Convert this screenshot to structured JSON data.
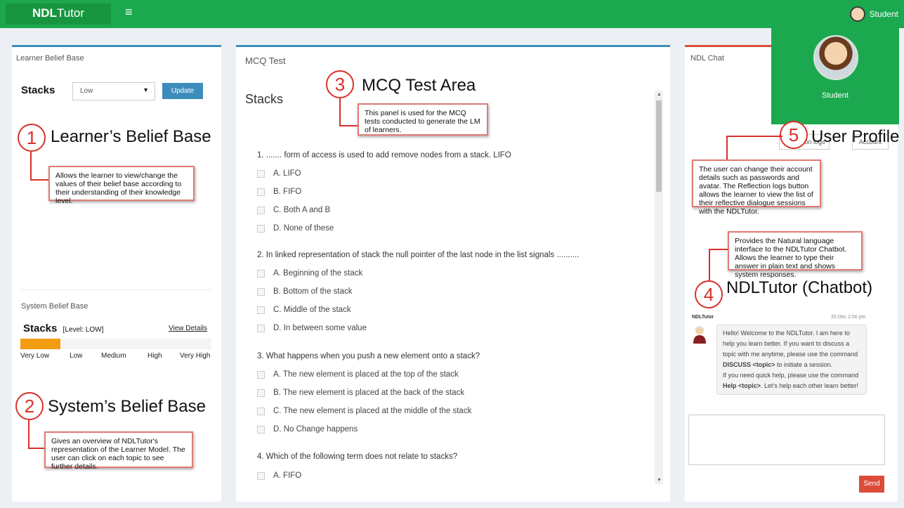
{
  "topbar": {
    "logo_bold": "NDL",
    "logo_rest": "Tutor",
    "menu_icon": "≡",
    "user_name": "Student"
  },
  "learner_belief": {
    "title": "Learner Belief Base",
    "topic": "Stacks",
    "select_value": "Low",
    "update_label": "Update"
  },
  "system_belief": {
    "title": "System Belief Base",
    "topic": "Stacks",
    "level_text": "[Level: LOW]",
    "view_details": "View Details",
    "level_fraction": 0.21,
    "scale": [
      "Very Low",
      "Low",
      "Medium",
      "High",
      "Very High"
    ]
  },
  "mcq": {
    "title": "MCQ Test",
    "topic": "Stacks",
    "questions": [
      {
        "q": "1. ....... form of access is used to add remove nodes from a stack. LIFO",
        "options": [
          "A. LIFO",
          "B. FIFO",
          "C. Both A and B",
          "D. None of these"
        ]
      },
      {
        "q": "2. In linked representation of stack the null pointer of the last node in the list signals ..........",
        "options": [
          "A. Beginning of the stack",
          "B. Bottom of the stack",
          "C. Middle of the stack",
          "D. In between some value"
        ]
      },
      {
        "q": "3. What happens when you push a new element onto a stack?",
        "options": [
          "A. The new element is placed at the top of the stack",
          "B. The new element is placed at the back of the stack",
          "C. The new element is placed at the middle of the stack",
          "D. No Change happens"
        ]
      },
      {
        "q": "4. Which of the following term does not relate to stacks?",
        "options": [
          "A. FIFO"
        ]
      }
    ]
  },
  "chat": {
    "title": "NDL Chat",
    "reflection_btn": "Reflection logs",
    "account_btn": "Account",
    "sender": "NDLTutor",
    "timestamp": "20 Dec 2:00 pm",
    "message_parts": [
      "Hello! Welcome to the NDLTutor. I am here to help you learn better. If you want to discuss a topic with me anytime, please use the command ",
      "DISCUSS <topic>",
      " to initiate a session.",
      "If you need quick help, please use the command ",
      "Help <topic>",
      ". Let's help each other learn better!"
    ],
    "send_label": "Send"
  },
  "profile": {
    "name": "Student"
  },
  "callouts": [
    {
      "num": "1",
      "title": "Learner’s Belief Base",
      "text": "Allows the learner to view/change the values of their belief base according to their understanding of their knowledge level."
    },
    {
      "num": "2",
      "title": "System’s Belief Base",
      "text": "Gives an overview of NDLTutor's representation of the Learner Model. The user can click on each topic to see further details."
    },
    {
      "num": "3",
      "title": "MCQ Test Area",
      "text": "This panel is used for the MCQ tests conducted to generate the LM of learners."
    },
    {
      "num": "4",
      "title": "NDLTutor (Chatbot)",
      "text": "Provides the Natural language interface to the NDLTutor Chatbot. Allows the learner to type their answer in plain text and shows system responses."
    },
    {
      "num": "5",
      "title": "User Profile",
      "text": "The user can change their account details such as passwords and avatar. The Reflection logs button allows the learner to view the list of their reflective dialogue sessions with the NDLTutor."
    }
  ]
}
